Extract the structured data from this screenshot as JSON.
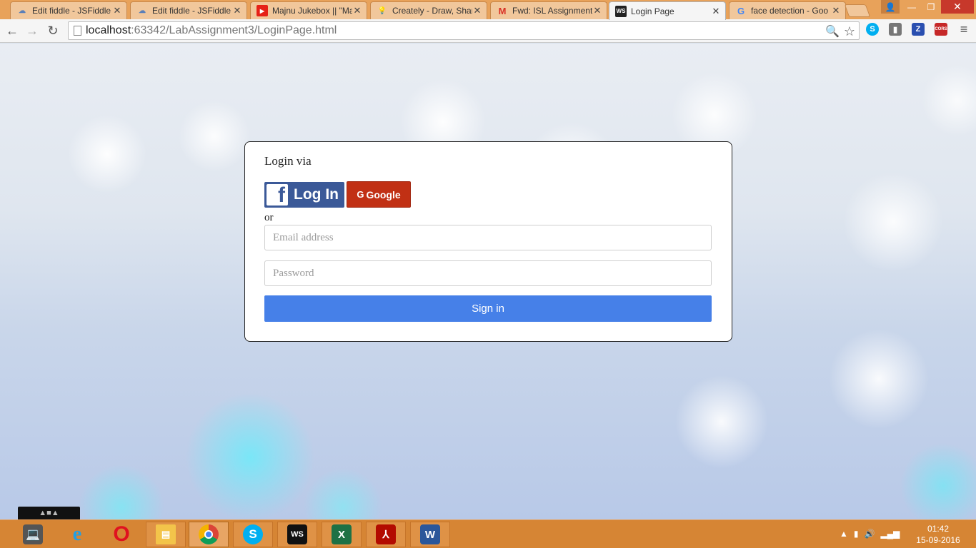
{
  "browser": {
    "tabs": [
      {
        "title": "Edit fiddle - JSFiddle",
        "icon": "cloud-icon",
        "active": false
      },
      {
        "title": "Edit fiddle - JSFiddle",
        "icon": "cloud-icon",
        "active": false
      },
      {
        "title": "Majnu Jukebox || \"Ma",
        "icon": "youtube-icon",
        "active": false
      },
      {
        "title": "Creately - Draw, Shar",
        "icon": "bulb-icon",
        "active": false
      },
      {
        "title": "Fwd: ISL Assignment",
        "icon": "gmail-icon",
        "active": false
      },
      {
        "title": "Login Page",
        "icon": "webstorm-icon",
        "active": true
      },
      {
        "title": "face detection - Goo",
        "icon": "google-icon",
        "active": false
      }
    ],
    "address": {
      "host": "localhost",
      "path": ":63342/LabAssignment3/LoginPage.html"
    },
    "extensions": [
      "skype-icon",
      "shield-icon",
      "z-icon",
      "cors-icon"
    ],
    "cors_label": "CORS",
    "z_label": "Z"
  },
  "login": {
    "heading": "Login via",
    "facebook_label": "Log In",
    "google_label": "Google",
    "google_letter": "G",
    "or_text": "or",
    "email_placeholder": "Email address",
    "password_placeholder": "Password",
    "signin_label": "Sign in"
  },
  "taskbar": {
    "apps": [
      "computer-icon",
      "ie-icon",
      "opera-icon",
      "file-explorer-icon",
      "chrome-icon",
      "skype-icon",
      "webstorm-icon",
      "excel-icon",
      "acrobat-icon",
      "word-icon"
    ],
    "ws_label": "WS",
    "time": "01:42",
    "date": "15-09-2016"
  },
  "colors": {
    "facebook": "#3b5998",
    "google": "#c13014",
    "signin": "#4680e8",
    "taskbar": "#d68534"
  }
}
